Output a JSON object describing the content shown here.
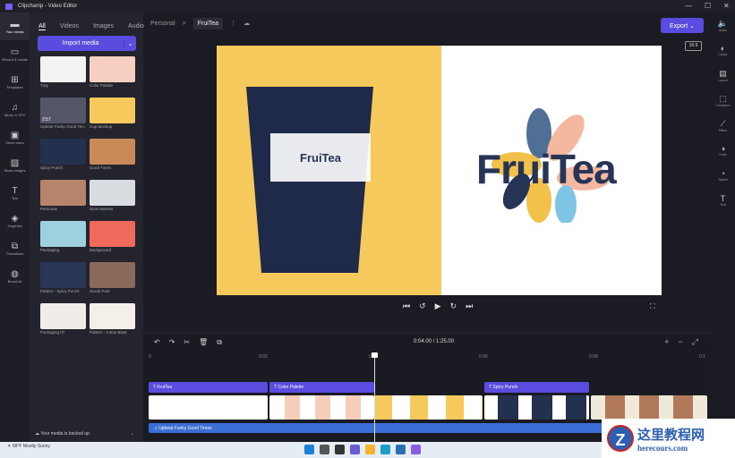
{
  "window": {
    "title": "Clipchamp - Video Editor",
    "min": "—",
    "max": "☐",
    "close": "✕"
  },
  "leftnav": [
    {
      "label": "Your media",
      "icon": "▬"
    },
    {
      "label": "Record & create",
      "icon": "▭"
    },
    {
      "label": "Templates",
      "icon": "⊞"
    },
    {
      "label": "Music & SFX",
      "icon": "♫"
    },
    {
      "label": "Stock video",
      "icon": "▣"
    },
    {
      "label": "Stock images",
      "icon": "▨"
    },
    {
      "label": "Text",
      "icon": "T"
    },
    {
      "label": "Graphics",
      "icon": "◈"
    },
    {
      "label": "Transitions",
      "icon": "⧉"
    },
    {
      "label": "Brand kit",
      "icon": "◍"
    }
  ],
  "media": {
    "tabs": [
      "All",
      "Videos",
      "Images",
      "Audio"
    ],
    "import": "Import media",
    "dropdown": "⌄",
    "items": [
      {
        "name": "Tray",
        "color": "#f3f3f3"
      },
      {
        "name": "Color Palette",
        "color": "#f5d0c0"
      },
      {
        "name": "Upbeat Funky Good Tim...",
        "color": "#55556a",
        "duration": "2:57"
      },
      {
        "name": "Cup Mockup",
        "color": "#f5c95c"
      },
      {
        "name": "Spicy Punch",
        "color": "#23314f"
      },
      {
        "name": "Good Times",
        "color": "#c98a5a"
      },
      {
        "name": "Personas",
        "color": "#b5846a"
      },
      {
        "name": "Store Banner",
        "color": "#d8dce0"
      },
      {
        "name": "Packaging",
        "color": "#9fd0e0"
      },
      {
        "name": "Background",
        "color": "#ef6a5a"
      },
      {
        "name": "Pattern - Spicy Punch",
        "color": "#2a3658"
      },
      {
        "name": "Social Post",
        "color": "#8a6a5a"
      },
      {
        "name": "Packaging 07",
        "color": "#f0ece8"
      },
      {
        "name": "Pattern - Citrus Blast",
        "color": "#f4efe8"
      }
    ],
    "backup": "Your media is backed up"
  },
  "breadcrumb": {
    "parent": "Personal",
    "sep": ">",
    "current": "FruiTea"
  },
  "export": "Export ⌄",
  "ratio": "16:9",
  "rightnav": [
    {
      "label": "Audio",
      "icon": "🔈"
    },
    {
      "label": "Colour",
      "icon": "◐"
    },
    {
      "label": "Layout",
      "icon": "▤"
    },
    {
      "label": "Transform",
      "icon": "⬚"
    },
    {
      "label": "Filters",
      "icon": "⟋"
    },
    {
      "label": "Fade",
      "icon": "◑"
    },
    {
      "label": "Speed",
      "icon": "◔"
    },
    {
      "label": "Text",
      "icon": "T"
    }
  ],
  "preview": {
    "cup_label": "FruiTea",
    "logo_text": "FruiTea"
  },
  "player": {
    "prev": "⏮",
    "back": "↺",
    "play": "▶",
    "fwd": "↻",
    "next": "⏭",
    "fullscreen": "⛶"
  },
  "timeline": {
    "current": "0:04.00",
    "sep": "/",
    "total": "1:25.00",
    "ruler": [
      "0",
      "0:02",
      "0:04",
      "0:06",
      "0:08",
      "0:1"
    ],
    "text_clips": [
      "FruiTea",
      "Color Palette",
      "Spicy Punch"
    ],
    "audio_clip": "Upbeat Funky Good Times"
  },
  "taskbar": {
    "temp": "68°F",
    "weather": "Mostly Sunny"
  },
  "watermark": {
    "title": "这里教程网",
    "url": "herecours.com"
  }
}
